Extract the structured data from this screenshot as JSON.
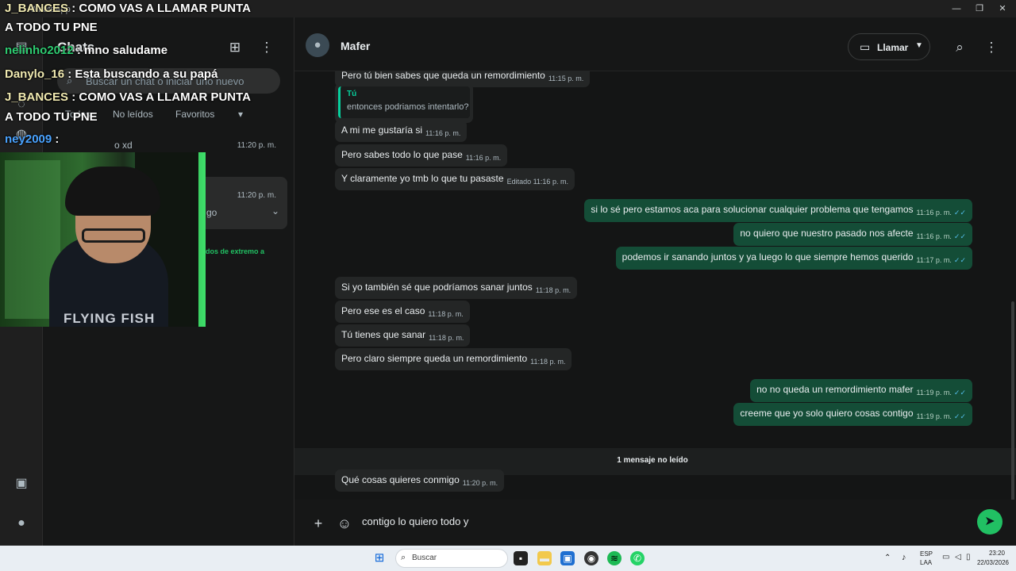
{
  "window": {
    "title": "WhatsApp",
    "minimize": "—",
    "maximize": "❐",
    "close": "✕"
  },
  "stream_overlay": {
    "lines": [
      {
        "user": "J_BANCES",
        "text": " : COMO VAS A LLAMAR PUNTA"
      },
      {
        "user": "",
        "text": "A TODO TU PNE"
      },
      {
        "user": "nelinho2012",
        "text": " : mno saludame"
      },
      {
        "user": "Danylo_16",
        "text": " : Esta buscando a su papá"
      },
      {
        "user": "J_BANCES",
        "text": " : COMO VAS A LLAMAR PUNTA"
      },
      {
        "user": "",
        "text": "A TODO TU PNE"
      },
      {
        "user": "ney2009",
        "text": " : "
      }
    ],
    "webcam_shirt_text": "FLYING FISH"
  },
  "sidebar": {
    "title": "Chats",
    "search_placeholder": "Buscar un chat o iniciar uno nuevo",
    "filters": [
      "Todos",
      "No leídos",
      "Favoritos",
      "▾"
    ],
    "chats": [
      {
        "snippet": "o xd",
        "time": "11:20 p. m."
      },
      {
        "snippet": "go",
        "time": "11:20 p. m."
      }
    ],
    "archived_note": "ados de extremo a"
  },
  "header": {
    "contact_name": "Mafer",
    "call_label": "Llamar"
  },
  "quote": {
    "name": "Tú",
    "text": "entonces podriamos intentarlo?"
  },
  "messages": [
    {
      "dir": "in",
      "text": "Pero tú bien sabes que queda un remordimiento",
      "time": "11:15 p. m."
    },
    {
      "dir": "in",
      "text": "A mi me gustaría si",
      "time": "11:16 p. m."
    },
    {
      "dir": "in",
      "text": "Pero sabes todo lo que pase",
      "time": "11:16 p. m."
    },
    {
      "dir": "in",
      "text": "Y claramente yo tmb lo que tu pasaste",
      "time": "Editado 11:16 p. m."
    },
    {
      "dir": "out",
      "text": "si lo sé pero estamos aca para solucionar cualquier problema que tengamos",
      "time": "11:16 p. m."
    },
    {
      "dir": "out",
      "text": "no quiero que nuestro pasado nos afecte",
      "time": "11:16 p. m."
    },
    {
      "dir": "out",
      "text": "podemos ir sanando juntos y ya luego lo que siempre hemos querido",
      "time": "11:17 p. m."
    },
    {
      "dir": "in",
      "text": "Si yo también sé que podríamos sanar juntos",
      "time": "11:18 p. m."
    },
    {
      "dir": "in",
      "text": "Pero ese es el caso",
      "time": "11:18 p. m."
    },
    {
      "dir": "in",
      "text": "Tú tienes que sanar",
      "time": "11:18 p. m."
    },
    {
      "dir": "in",
      "text": "Pero claro siempre queda un remordimiento",
      "time": "11:18 p. m."
    },
    {
      "dir": "out",
      "text": "no no queda un remordimiento mafer",
      "time": "11:19 p. m."
    },
    {
      "dir": "out",
      "text": "creeme que yo solo quiero cosas contigo",
      "time": "11:19 p. m."
    },
    {
      "dir": "in",
      "text": "Qué cosas quieres conmigo",
      "time": "11:20 p. m."
    }
  ],
  "unread_divider": "1 mensaje no leído",
  "composer": {
    "value": "contigo lo quiero todo y"
  },
  "taskbar": {
    "search_label": "Buscar",
    "lang_top": "ESP",
    "lang_bottom": "LAA",
    "time": "23:20",
    "date": "22/03/2026"
  },
  "colors": {
    "accent": "#21c063",
    "outgoing": "#144d37",
    "incoming": "#242626",
    "read_ticks": "#53bdeb"
  }
}
